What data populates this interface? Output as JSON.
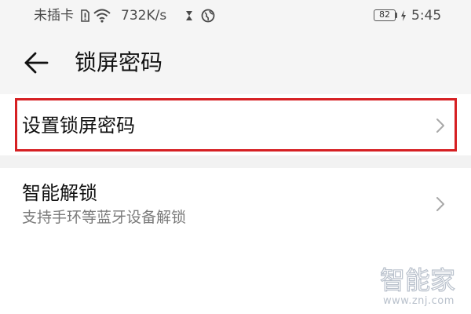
{
  "status_bar": {
    "carrier": "未插卡",
    "network_speed": "732K/s",
    "battery_level": "82",
    "time": "5:45",
    "icons": [
      "sim-card-icon",
      "wifi-icon",
      "hourglass-icon",
      "vpn-globe-icon",
      "charging-bolt-icon"
    ]
  },
  "header": {
    "title": "锁屏密码",
    "back_icon": "back-arrow-icon"
  },
  "settings": {
    "items": [
      {
        "label": "设置锁屏密码",
        "sublabel": "",
        "highlighted": true
      },
      {
        "label": "智能解锁",
        "sublabel": "支持手环等蓝牙设备解锁",
        "highlighted": false
      }
    ]
  },
  "watermark": {
    "brand": "智能家",
    "url": "www.znj.com"
  },
  "colors": {
    "topbar_background": "#f5f5f5",
    "highlight_border": "#d62023",
    "primary_text": "#111111",
    "secondary_text": "#7a7a7a",
    "watermark": "#b9c1cc"
  }
}
